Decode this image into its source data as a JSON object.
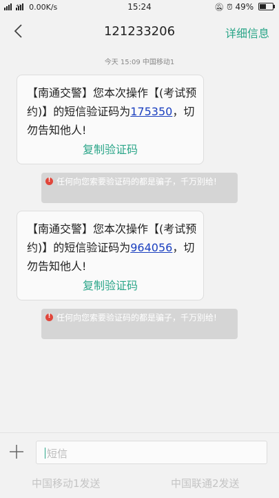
{
  "status_bar": {
    "network": "⁴ᴳ",
    "speed": "0.00K/s",
    "time": "15:24",
    "battery": "49%",
    "battery_level": 0.49
  },
  "header": {
    "title": "121233206",
    "detail_label": "详细信息"
  },
  "timestamp": "今天 15:09 中国移动1",
  "messages": [
    {
      "text_before": "【南通交警】您本次操作【(考试预约)】的短信验证码为",
      "code": "175350",
      "text_after": "，切勿告知他人!",
      "copy_label": "复制验证码",
      "warning": "任何向您索要验证码的都是骗子，千万别给!"
    },
    {
      "text_before": "【南通交警】您本次操作【(考试预约)】的短信验证码为",
      "code": "964056",
      "text_after": "，切勿告知他人!",
      "copy_label": "复制验证码",
      "warning": "任何向您索要验证码的都是骗子，千万别给!"
    }
  ],
  "compose": {
    "placeholder": "短信",
    "send_sim1": "中国移动1发送",
    "send_sim2": "中国联通2发送"
  },
  "colors": {
    "accent": "#2aa588",
    "link": "#1a3fbf",
    "warning_icon": "#e0463b"
  }
}
